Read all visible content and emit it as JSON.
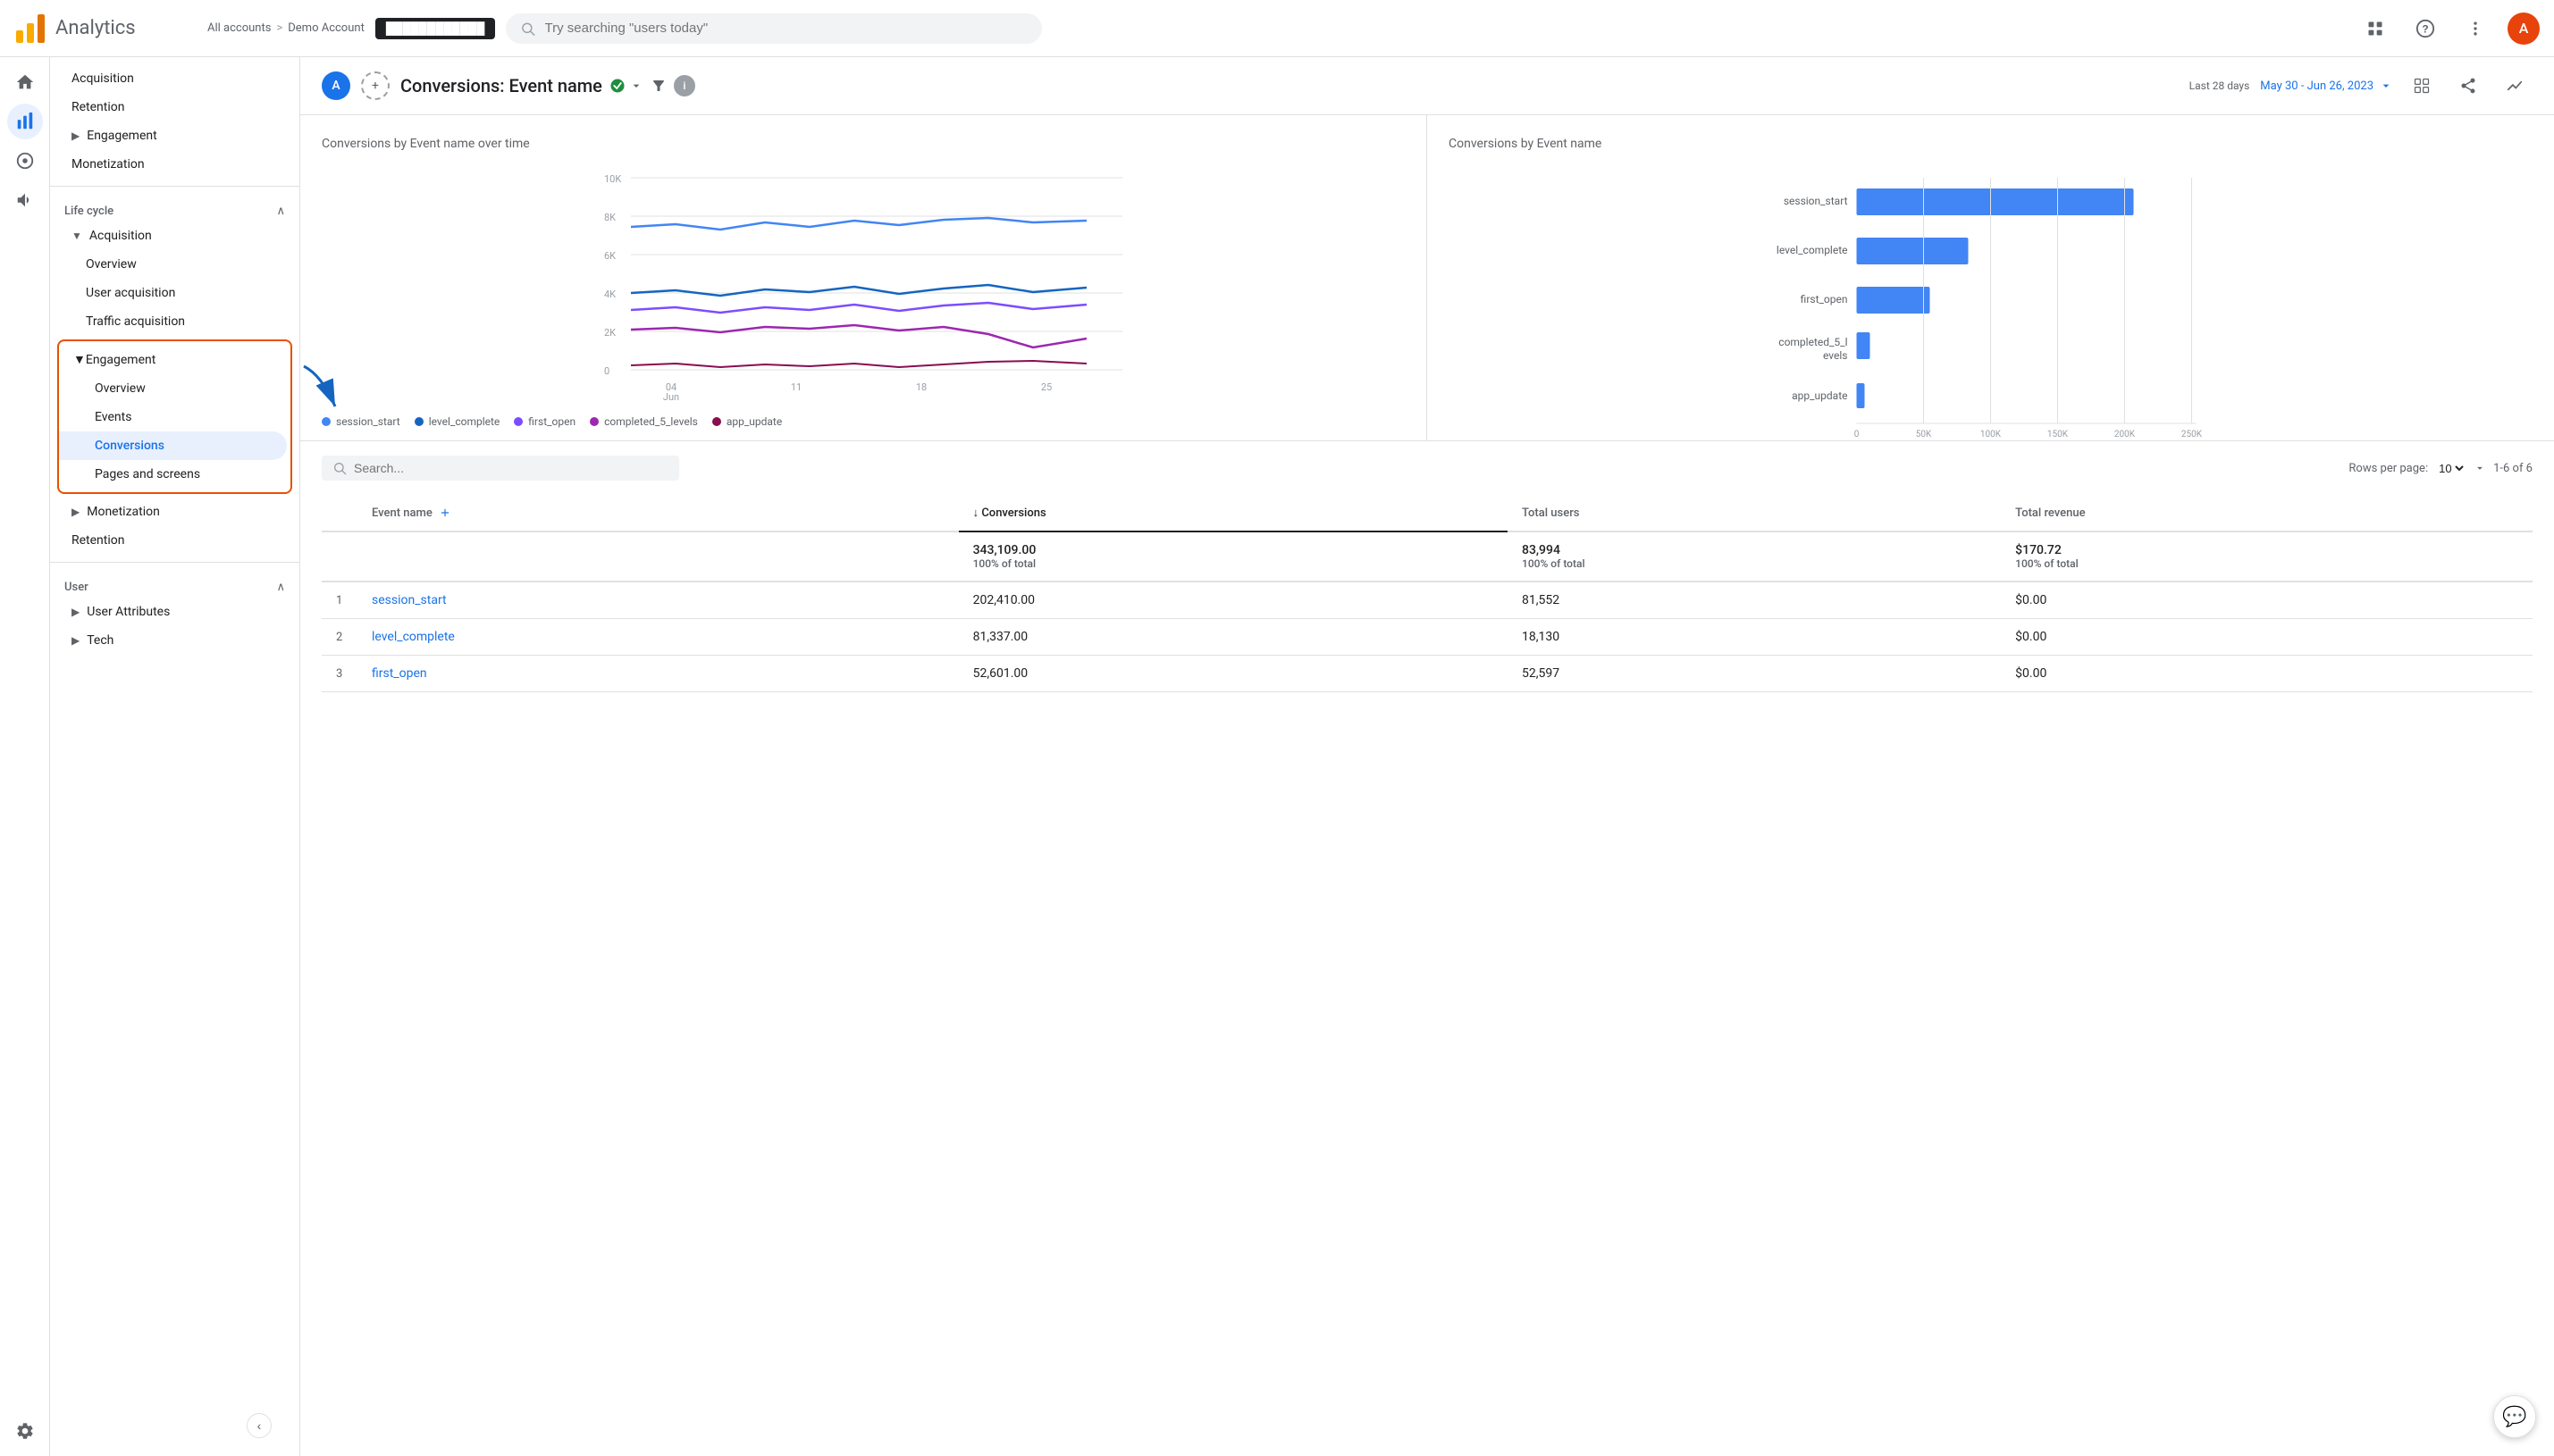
{
  "app": {
    "title": "Analytics",
    "breadcrumb_all": "All accounts",
    "breadcrumb_sep": ">",
    "breadcrumb_account": "Demo Account",
    "account_masked": "████████████"
  },
  "search": {
    "placeholder": "Try searching \"users today\""
  },
  "top_icons": {
    "grid_label": "Grid",
    "help_label": "Help",
    "more_label": "More",
    "avatar_label": "A"
  },
  "nav_icons": [
    {
      "name": "home",
      "symbol": "⌂",
      "active": false
    },
    {
      "name": "reports",
      "symbol": "📊",
      "active": true
    },
    {
      "name": "explore",
      "symbol": "🔍",
      "active": false
    },
    {
      "name": "advertising",
      "symbol": "📣",
      "active": false
    }
  ],
  "sidebar": {
    "sections": [
      {
        "type": "item",
        "label": "Acquisition",
        "indent": 1
      },
      {
        "type": "item",
        "label": "Retention",
        "indent": 1
      },
      {
        "type": "item",
        "label": "Engagement",
        "indent": 1,
        "expandable": true
      },
      {
        "type": "item",
        "label": "Monetization",
        "indent": 1
      }
    ],
    "lifecycle_header": "Life cycle",
    "lifecycle_items": [
      {
        "label": "Acquisition",
        "expandable": true,
        "expanded": true
      },
      {
        "label": "Overview",
        "sub": true
      },
      {
        "label": "User acquisition",
        "sub": true
      },
      {
        "label": "Traffic acquisition",
        "sub": true
      }
    ],
    "engagement_label": "Engagement",
    "engagement_expanded": true,
    "engagement_subitems": [
      {
        "label": "Overview"
      },
      {
        "label": "Events"
      },
      {
        "label": "Conversions",
        "active": true
      },
      {
        "label": "Pages and screens"
      }
    ],
    "monetization_label": "Monetization",
    "retention_label": "Retention",
    "user_header": "User",
    "user_items": [
      {
        "label": "User Attributes",
        "expandable": true
      },
      {
        "label": "Tech",
        "expandable": true
      }
    ],
    "settings_label": "Settings",
    "collapse_label": "‹"
  },
  "report": {
    "avatar_label": "A",
    "add_label": "+",
    "title": "Conversions: Event name",
    "date_range_label": "Last 28 days",
    "date_range": "May 30 - Jun 26, 2023",
    "actions": {
      "export": "⊞",
      "share": "⤴",
      "compare": "∿"
    }
  },
  "line_chart": {
    "title": "Conversions by Event name over time",
    "y_axis": [
      "10K",
      "8K",
      "6K",
      "4K",
      "2K",
      "0"
    ],
    "x_axis": [
      "04\nJun",
      "11",
      "18",
      "25"
    ],
    "series": [
      {
        "label": "session_start",
        "color": "#4285f4"
      },
      {
        "label": "level_complete",
        "color": "#1565c0"
      },
      {
        "label": "first_open",
        "color": "#7c4dff"
      },
      {
        "label": "completed_5_levels",
        "color": "#9c27b0"
      },
      {
        "label": "app_update",
        "color": "#880e4f"
      }
    ]
  },
  "bar_chart": {
    "title": "Conversions by Event name",
    "y_labels": [
      "session_start",
      "level_complete",
      "first_open",
      "completed_5_l\nevels",
      "app_update"
    ],
    "x_axis": [
      "0",
      "50K",
      "100K",
      "150K",
      "200K",
      "250K"
    ],
    "bars": [
      {
        "label": "session_start",
        "value": 202410,
        "width": 82
      },
      {
        "label": "level_complete",
        "value": 81337,
        "width": 33
      },
      {
        "label": "first_open",
        "value": 52601,
        "width": 22
      },
      {
        "label": "completed_5_levels",
        "value": 4200,
        "width": 4
      },
      {
        "label": "app_update",
        "value": 2561,
        "width": 2
      }
    ],
    "color": "#4285f4"
  },
  "table": {
    "search_placeholder": "Search...",
    "rows_per_page_label": "Rows per page:",
    "rows_per_page": "10",
    "pagination": "1-6 of 6",
    "columns": [
      {
        "label": "Event name",
        "key": "event_name"
      },
      {
        "label": "↓ Conversions",
        "key": "conversions",
        "sorted": true
      },
      {
        "label": "Total users",
        "key": "total_users"
      },
      {
        "label": "Total revenue",
        "key": "total_revenue"
      }
    ],
    "totals": {
      "conversions": "343,109.00",
      "conversions_pct": "100% of total",
      "total_users": "83,994",
      "total_users_pct": "100% of total",
      "total_revenue": "$170.72",
      "total_revenue_pct": "100% of total"
    },
    "rows": [
      {
        "num": 1,
        "event_name": "session_start",
        "conversions": "202,410.00",
        "total_users": "81,552",
        "total_revenue": "$0.00"
      },
      {
        "num": 2,
        "event_name": "level_complete",
        "conversions": "81,337.00",
        "total_users": "18,130",
        "total_revenue": "$0.00"
      },
      {
        "num": 3,
        "event_name": "first_open",
        "conversions": "52,601.00",
        "total_users": "52,597",
        "total_revenue": "$0.00"
      }
    ]
  },
  "chat_icon": "💬"
}
